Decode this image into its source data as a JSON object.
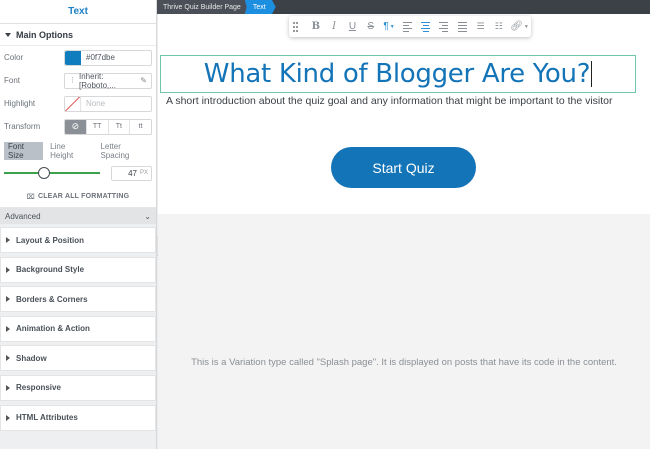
{
  "sidebar": {
    "header": "Text",
    "main_options": {
      "title": "Main Options",
      "color": {
        "label": "Color",
        "value": "#0f7dbe",
        "swatch": "#0f7dbe"
      },
      "font": {
        "label": "Font",
        "value": "Inherit: [Roboto,..."
      },
      "highlight": {
        "label": "Highlight",
        "placeholder": "None"
      },
      "transform": {
        "label": "Transform",
        "options": [
          "⊘",
          "TT",
          "Tt",
          "tt"
        ]
      },
      "tabs": [
        "Font Size",
        "Line Height",
        "Letter Spacing"
      ],
      "font_size": {
        "value": "47",
        "unit": "PX",
        "fraction": 0.42
      },
      "clear_label": "CLEAR ALL FORMATTING"
    },
    "advanced_label": "Advanced",
    "panels": [
      "Layout & Position",
      "Background Style",
      "Borders & Corners",
      "Animation & Action",
      "Shadow",
      "Responsive",
      "HTML Attributes"
    ]
  },
  "breadcrumb": {
    "page": "Thrive Quiz Builder Page",
    "current": "Text"
  },
  "toolbar": {
    "items": [
      "bold-icon",
      "italic-icon",
      "underline-icon",
      "strikethrough-icon",
      "paragraph-icon",
      "align-left-icon",
      "align-center-icon",
      "align-right-icon",
      "align-justify-icon",
      "bullet-list-icon",
      "numbered-list-icon",
      "link-icon"
    ]
  },
  "hero": {
    "title": "What Kind of Blogger Are You?",
    "subtitle": "A short introduction about the quiz goal and any information that might be important to the visitor",
    "button": "Start Quiz"
  },
  "variation_note": "This is a Variation type called \"Splash page\". It is displayed on posts that have its code in the content.",
  "colors": {
    "accent": "#1474b8",
    "topbar": "#3c4148",
    "crumb_active": "#1d8fe0",
    "slider": "#3ca14a"
  }
}
